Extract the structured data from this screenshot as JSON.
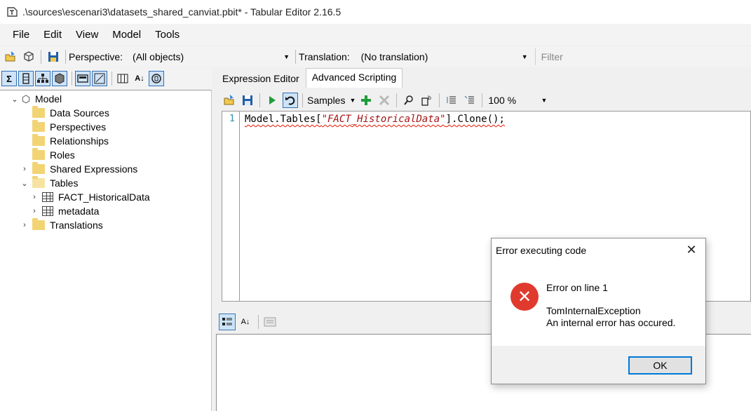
{
  "window": {
    "title": ".\\sources\\escenari3\\datasets_shared_canviat.pbit* - Tabular Editor 2.16.5"
  },
  "menu": [
    "File",
    "Edit",
    "View",
    "Model",
    "Tools"
  ],
  "toolbar": {
    "perspective_label": "Perspective:",
    "perspective_value": "(All objects)",
    "translation_label": "Translation:",
    "translation_value": "(No translation)",
    "filter_placeholder": "Filter"
  },
  "tree": {
    "root": "Model",
    "items": [
      {
        "label": "Data Sources"
      },
      {
        "label": "Perspectives"
      },
      {
        "label": "Relationships"
      },
      {
        "label": "Roles"
      },
      {
        "label": "Shared Expressions"
      },
      {
        "label": "Tables"
      },
      {
        "label": "FACT_HistoricalData"
      },
      {
        "label": "metadata"
      },
      {
        "label": "Translations"
      }
    ]
  },
  "tabs": [
    {
      "label": "Expression Editor",
      "active": false
    },
    {
      "label": "Advanced Scripting",
      "active": true
    }
  ],
  "editor_toolbar": {
    "samples_label": "Samples",
    "zoom": "100 %"
  },
  "editor": {
    "line_number": "1",
    "code_prefix": "Model.Tables[",
    "code_string": "\"FACT_HistoricalData\"",
    "code_suffix": "].Clone();"
  },
  "dialog": {
    "title": "Error executing code",
    "line1": "Error on line 1",
    "line2": "TomInternalException",
    "line3": "An internal error has occured.",
    "ok_label": "OK",
    "error_color": "#e03a2e"
  }
}
